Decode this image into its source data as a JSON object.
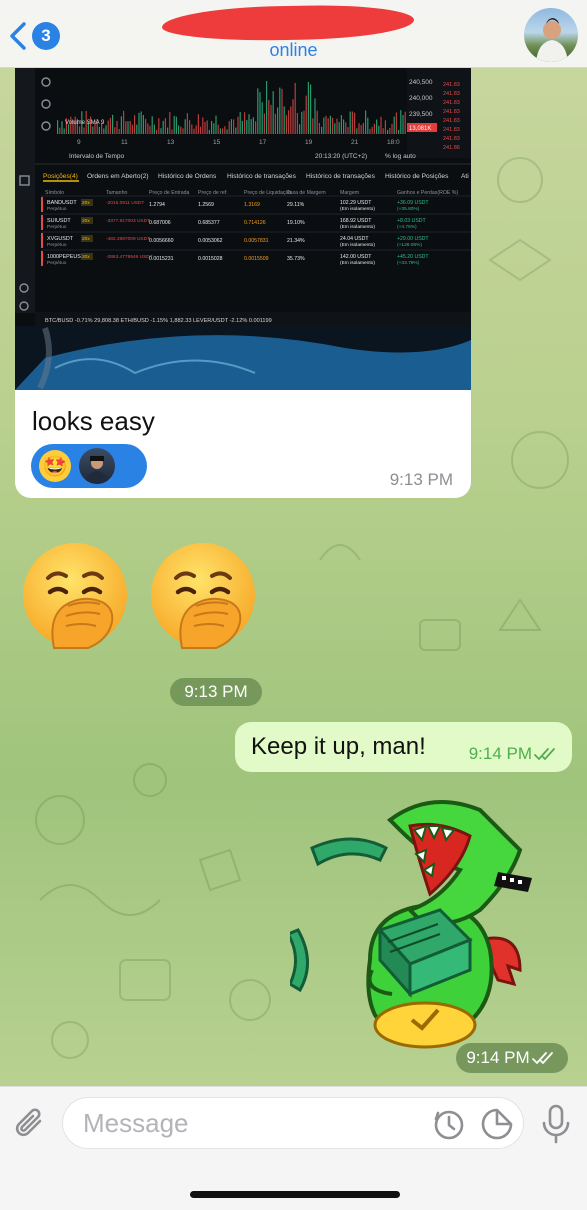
{
  "header": {
    "back_badge": "3",
    "status": "online"
  },
  "incoming_photo": {
    "caption": "looks easy",
    "time": "9:13 PM",
    "reaction_emoji": "🤩",
    "screenshot": {
      "chart_prices": [
        "240,500",
        "240,000",
        "239,500"
      ],
      "side_prices": [
        "241.83",
        "241.83",
        "241.83",
        "241.83",
        "241.83",
        "241.83",
        "241.83",
        "241.86"
      ],
      "price_tag": "13,081K",
      "volume_label": "Volume SMA 9",
      "xaxis": [
        "9",
        "11",
        "13",
        "15",
        "17",
        "19",
        "21",
        "18:0"
      ],
      "interval_label": "Intervalo de Tempo",
      "clock": "20:13:20 (UTC+2)",
      "log_label": "% log auto",
      "tabs": [
        "Posições(4)",
        "Ordens em Aberto(2)",
        "Histórico de Ordens",
        "Histórico de transações",
        "Histórico de transações",
        "Histórico de Posições",
        "Ati"
      ],
      "columns": [
        "Símbolo",
        "Tamanho",
        "Preço de Entrada",
        "Preço de ref.",
        "Preço de Liquidação",
        "Taxa de Margem",
        "Margem",
        "Ganhos e Perdas(ROE %)"
      ],
      "rows": [
        {
          "symbol": "BANDUSDT",
          "sub": "Perpétuo",
          "lev": "20x",
          "size": "-2016.0911 USDT",
          "entry": "1.2794",
          "ref": "1.2569",
          "liq": "1.3169",
          "rate": "29.11%",
          "margin": "102.29 USDT",
          "margin_sub": "(Em isolamento)",
          "pnl": "+36.09 USDT",
          "roe": "(+35.80%)"
        },
        {
          "symbol": "SUIUSDT",
          "sub": "Perpétuo",
          "lev": "20x",
          "size": "-3377.817003 USDT",
          "entry": "0.687006",
          "ref": "0.685377",
          "liq": "0.714126",
          "rate": "19.10%",
          "margin": "168.92 USDT",
          "margin_sub": "(Em isolamento)",
          "pnl": "+8.03 USDT",
          "roe": "(+4.76%)"
        },
        {
          "symbol": "XVGUSDT",
          "sub": "Perpétuo",
          "lev": "20x",
          "size": "-482.3697009 USDT",
          "entry": "0.0056660",
          "ref": "0.0053062",
          "liq": "0.0057831",
          "rate": "21.34%",
          "margin": "24.04 USDT",
          "margin_sub": "(Em isolamento)",
          "pnl": "+29.00 USDT",
          "roe": "(+128.08%)"
        },
        {
          "symbol": "1000PEPEUSDT",
          "sub": "Perpétuo",
          "lev": "20x",
          "size": "-2863.4779946 USDT",
          "entry": "0.0015231",
          "ref": "0.0015028",
          "liq": "0.0015509",
          "rate": "35.73%",
          "margin": "142.00 USDT",
          "margin_sub": "(Em isolamento)",
          "pnl": "+45.20 USDT",
          "roe": "(+33.79%)"
        }
      ],
      "ticker": "BTC/BUSD -0.71% 29,808.38   ETH/BUSD -1.15% 1,882.33   LEVER/USDT -2.12% 0.001199"
    }
  },
  "emoji_message": {
    "emojis": [
      "🤭",
      "🤭"
    ],
    "time": "9:13 PM"
  },
  "outgoing_text": {
    "text": "Keep it up, man!",
    "time": "9:14 PM"
  },
  "sticker_message": {
    "time": "9:14 PM"
  },
  "composer": {
    "placeholder": "Message"
  },
  "colors": {
    "accent": "#2a82e4",
    "outgoing_bubble": "#e2f9c8",
    "read_check": "#4fae4e"
  }
}
